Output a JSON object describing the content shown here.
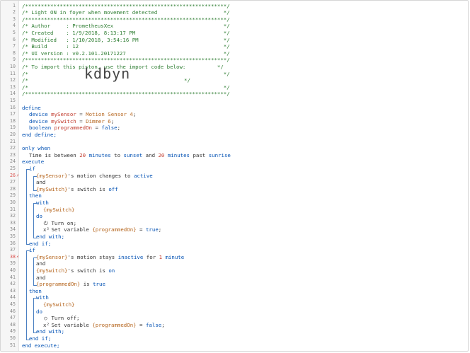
{
  "alert_icon": "lightning-icon",
  "lines": [
    {
      "n": 1,
      "segs": [
        [
          "c",
          "/****************************************************************/"
        ]
      ]
    },
    {
      "n": 2,
      "segs": [
        [
          "c",
          "/* Light ON in foyer when movement detected                     */"
        ]
      ]
    },
    {
      "n": 3,
      "segs": [
        [
          "c",
          "/****************************************************************/"
        ]
      ]
    },
    {
      "n": 4,
      "segs": [
        [
          "c",
          "/* Author     : PrometheusXex                                   */"
        ]
      ]
    },
    {
      "n": 5,
      "segs": [
        [
          "c",
          "/* Created    : 1/9/2018, 8:13:17 PM                            */"
        ]
      ]
    },
    {
      "n": 6,
      "segs": [
        [
          "c",
          "/* Modified   : 1/10/2018, 3:54:16 PM                           */"
        ]
      ]
    },
    {
      "n": 7,
      "segs": [
        [
          "c",
          "/* Build      : 12                                              */"
        ]
      ]
    },
    {
      "n": 8,
      "segs": [
        [
          "c",
          "/* UI version : v0.2.101.20171227                               */"
        ]
      ]
    },
    {
      "n": 9,
      "segs": [
        [
          "c",
          "/****************************************************************/"
        ]
      ]
    },
    {
      "n": 10,
      "segs": [
        [
          "c",
          "/* To import this piston, use the import code below:          */"
        ]
      ]
    },
    {
      "n": 11,
      "segs": [
        [
          "c",
          "/*                                                              */"
        ]
      ]
    },
    {
      "n": 12,
      "segs": [
        [
          "c",
          "/*"
        ]
      ],
      "code": "kdbyn",
      "segs_after": [
        [
          "c",
          "*/"
        ]
      ]
    },
    {
      "n": 13,
      "segs": [
        [
          "c",
          "/*                                                              */"
        ]
      ]
    },
    {
      "n": 14,
      "segs": [
        [
          "c",
          "/****************************************************************/"
        ]
      ]
    },
    {
      "n": 15,
      "segs": []
    },
    {
      "n": 16,
      "segs": [
        [
          "k",
          "define"
        ]
      ]
    },
    {
      "n": 17,
      "indent": 1,
      "segs": [
        [
          "k",
          "device "
        ],
        [
          "v",
          "mySensor"
        ],
        [
          "o",
          " = "
        ],
        [
          "d",
          "Motion Sensor 4"
        ],
        [
          "t",
          ";"
        ]
      ]
    },
    {
      "n": 18,
      "indent": 1,
      "segs": [
        [
          "k",
          "device "
        ],
        [
          "v",
          "mySwitch"
        ],
        [
          "o",
          " = "
        ],
        [
          "d",
          "Dimmer 6"
        ],
        [
          "t",
          ";"
        ]
      ]
    },
    {
      "n": 19,
      "indent": 1,
      "segs": [
        [
          "k",
          "boolean "
        ],
        [
          "v",
          "programmedOn"
        ],
        [
          "o",
          " = "
        ],
        [
          "k",
          "false"
        ],
        [
          "t",
          ";"
        ]
      ]
    },
    {
      "n": 20,
      "segs": [
        [
          "k",
          "end define;"
        ]
      ]
    },
    {
      "n": 21,
      "segs": []
    },
    {
      "n": 22,
      "segs": [
        [
          "k",
          "only when"
        ]
      ]
    },
    {
      "n": 23,
      "indent": 1,
      "segs": [
        [
          "t",
          "Time is between "
        ],
        [
          "n",
          "20"
        ],
        [
          "t",
          " "
        ],
        [
          "k",
          "minutes"
        ],
        [
          "t",
          " to "
        ],
        [
          "k",
          "sunset"
        ],
        [
          "t",
          " and "
        ],
        [
          "n",
          "20"
        ],
        [
          "t",
          " "
        ],
        [
          "k",
          "minutes"
        ],
        [
          "t",
          " past "
        ],
        [
          "k",
          "sunrise"
        ]
      ]
    },
    {
      "n": 24,
      "segs": [
        [
          "k",
          "execute"
        ]
      ]
    },
    {
      "n": 25,
      "indent": 1,
      "segs": [
        [
          "k",
          "if"
        ]
      ]
    },
    {
      "n": 26,
      "indent": 2,
      "alert": true,
      "segs": [
        [
          "d",
          "{mySensor}"
        ],
        [
          "t",
          "'s motion changes to "
        ],
        [
          "k",
          "active"
        ]
      ]
    },
    {
      "n": 27,
      "indent": 2,
      "segs": [
        [
          "t",
          "and"
        ]
      ]
    },
    {
      "n": 28,
      "indent": 2,
      "segs": [
        [
          "d",
          "{mySwitch}"
        ],
        [
          "t",
          "'s switch is "
        ],
        [
          "k",
          "off"
        ]
      ]
    },
    {
      "n": 29,
      "indent": 1,
      "segs": [
        [
          "k",
          "then"
        ]
      ]
    },
    {
      "n": 30,
      "indent": 2,
      "segs": [
        [
          "k",
          "with"
        ]
      ]
    },
    {
      "n": 31,
      "indent": 3,
      "segs": [
        [
          "d",
          "{mySwitch}"
        ]
      ]
    },
    {
      "n": 32,
      "indent": 2,
      "segs": [
        [
          "k",
          "do"
        ]
      ]
    },
    {
      "n": 33,
      "indent": 3,
      "icon": "power-icon",
      "segs": [
        [
          "t",
          "Turn on;"
        ]
      ]
    },
    {
      "n": 34,
      "indent": 3,
      "icon": "variable-icon",
      "segs": [
        [
          "t",
          "Set variable "
        ],
        [
          "d",
          "{programmedOn}"
        ],
        [
          "t",
          " = "
        ],
        [
          "k",
          "true"
        ],
        [
          "t",
          ";"
        ]
      ]
    },
    {
      "n": 35,
      "indent": 2,
      "segs": [
        [
          "k",
          "end with;"
        ]
      ]
    },
    {
      "n": 36,
      "indent": 1,
      "segs": [
        [
          "k",
          "end if;"
        ]
      ]
    },
    {
      "n": 37,
      "indent": 1,
      "segs": [
        [
          "k",
          "if"
        ]
      ]
    },
    {
      "n": 38,
      "indent": 2,
      "alert": true,
      "segs": [
        [
          "d",
          "{mySensor}"
        ],
        [
          "t",
          "'s motion stays "
        ],
        [
          "k",
          "inactive"
        ],
        [
          "t",
          " for "
        ],
        [
          "n",
          "1"
        ],
        [
          "t",
          " "
        ],
        [
          "k",
          "minute"
        ]
      ]
    },
    {
      "n": 39,
      "indent": 2,
      "segs": [
        [
          "t",
          "and"
        ]
      ]
    },
    {
      "n": 40,
      "indent": 2,
      "segs": [
        [
          "d",
          "{mySwitch}"
        ],
        [
          "t",
          "'s switch is "
        ],
        [
          "k",
          "on"
        ]
      ]
    },
    {
      "n": 41,
      "indent": 2,
      "segs": [
        [
          "t",
          "and"
        ]
      ]
    },
    {
      "n": 42,
      "indent": 2,
      "segs": [
        [
          "d",
          "{programmedOn}"
        ],
        [
          "t",
          " is "
        ],
        [
          "k",
          "true"
        ]
      ]
    },
    {
      "n": 43,
      "indent": 1,
      "segs": [
        [
          "k",
          "then"
        ]
      ]
    },
    {
      "n": 44,
      "indent": 2,
      "segs": [
        [
          "k",
          "with"
        ]
      ]
    },
    {
      "n": 45,
      "indent": 3,
      "segs": [
        [
          "d",
          "{mySwitch}"
        ]
      ]
    },
    {
      "n": 46,
      "indent": 2,
      "segs": [
        [
          "k",
          "do"
        ]
      ]
    },
    {
      "n": 47,
      "indent": 3,
      "icon": "power-off-icon",
      "segs": [
        [
          "t",
          "Turn off;"
        ]
      ]
    },
    {
      "n": 48,
      "indent": 3,
      "icon": "variable-icon",
      "segs": [
        [
          "t",
          "Set variable "
        ],
        [
          "d",
          "{programmedOn}"
        ],
        [
          "t",
          " = "
        ],
        [
          "k",
          "false"
        ],
        [
          "t",
          ";"
        ]
      ]
    },
    {
      "n": 49,
      "indent": 2,
      "segs": [
        [
          "k",
          "end with;"
        ]
      ]
    },
    {
      "n": 50,
      "indent": 1,
      "segs": [
        [
          "k",
          "end if;"
        ]
      ]
    },
    {
      "n": 51,
      "segs": [
        [
          "k",
          "end execute;"
        ]
      ]
    }
  ]
}
